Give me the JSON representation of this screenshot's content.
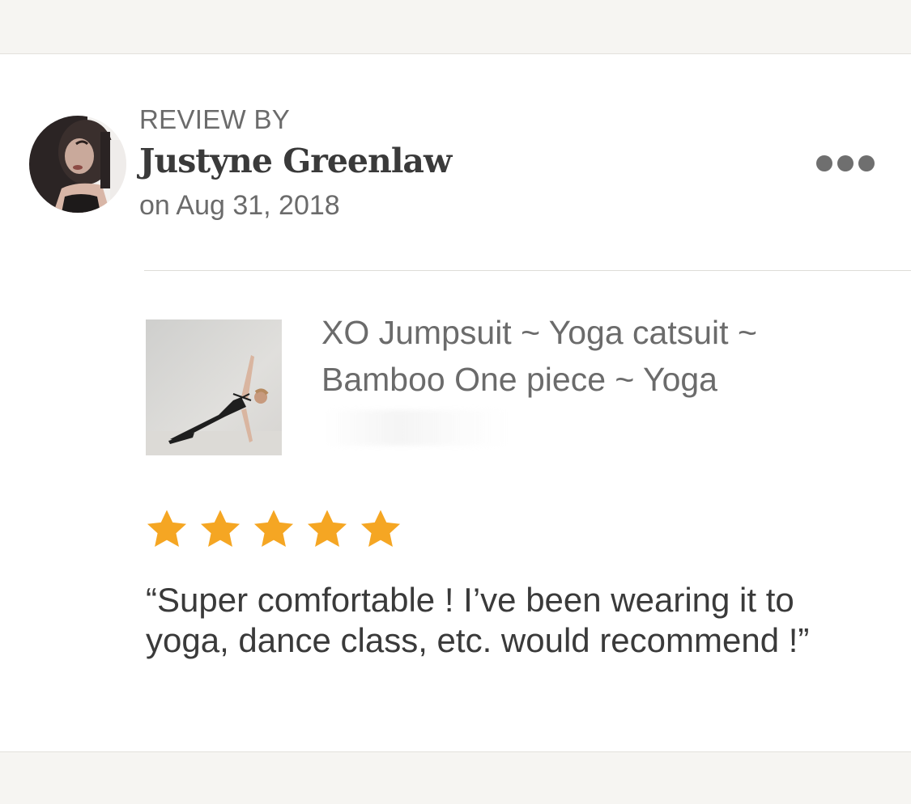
{
  "review": {
    "label": "REVIEW BY",
    "reviewer_name": "Justyne Greenlaw",
    "date": "on Aug 31, 2018",
    "rating": 5,
    "rating_max": 5,
    "text": "“Super comfortable ! I’ve been wearing it to yoga, dance class, etc. would recommend !”"
  },
  "product": {
    "title": "XO Jumpsuit ~ Yoga catsuit ~ Bamboo One piece ~ Yoga"
  },
  "icons": {
    "more": "more-options-icon",
    "star": "star-icon"
  },
  "colors": {
    "star": "#f5a623",
    "page_background": "#f6f5f2",
    "card_background": "#ffffff",
    "text_primary": "#3a3a3a",
    "text_secondary": "#6b6b6b"
  }
}
